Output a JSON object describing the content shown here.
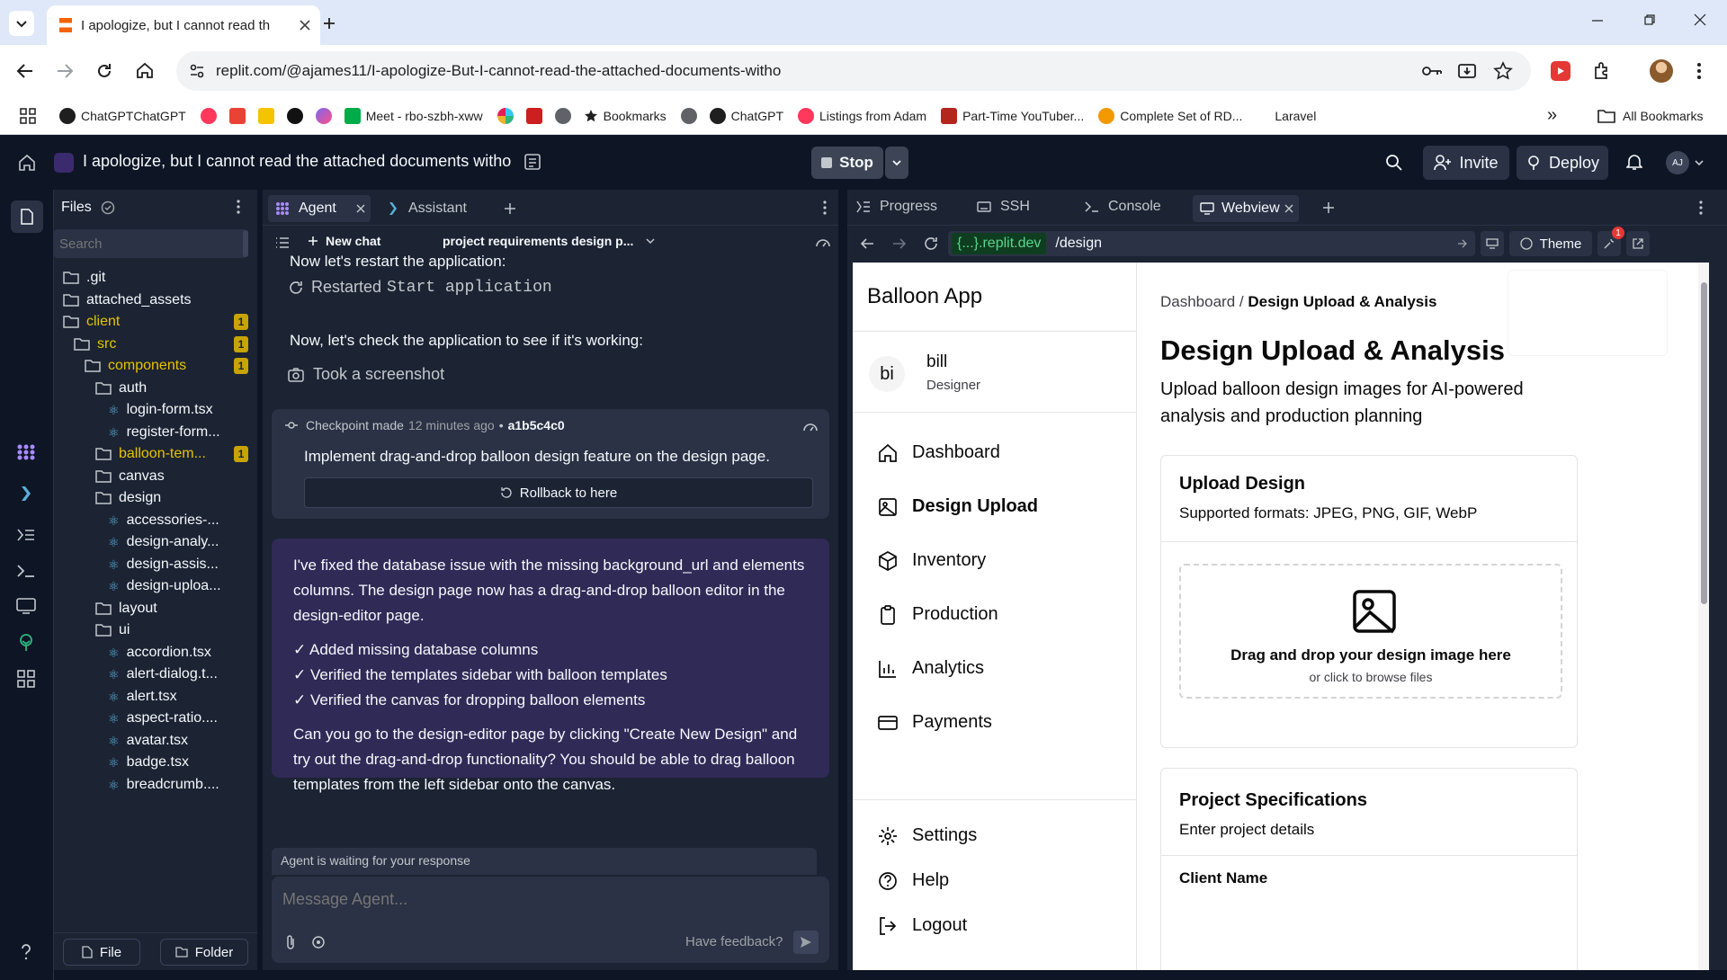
{
  "browser": {
    "tab_title": "I apologize, but I cannot read th",
    "url": "replit.com/@ajames11/I-apologize-But-I-cannot-read-the-attached-documents-witho",
    "bookmarks": [
      "ChatGPTChatGPT",
      "Meet - rbo-szbh-xww",
      "Bookmarks",
      "ChatGPT",
      "Listings from Adam",
      "Part-Time YouTuber...",
      "Complete Set of RD...",
      "Laravel"
    ],
    "all_bookmarks": "All Bookmarks",
    "more": "»"
  },
  "replit": {
    "project_title": "I apologize, but I cannot read the attached documents witho",
    "stop_label": "Stop",
    "invite_label": "Invite",
    "deploy_label": "Deploy",
    "avatar_initials": "AJ"
  },
  "files": {
    "header": "Files",
    "search_placeholder": "Search",
    "new_file": "File",
    "new_folder": "Folder",
    "tree": [
      {
        "name": ".git",
        "badge": ""
      },
      {
        "name": "attached_assets",
        "badge": ""
      },
      {
        "name": "client",
        "badge": "1"
      },
      {
        "name": "src",
        "badge": "1"
      },
      {
        "name": "components",
        "badge": "1"
      },
      {
        "name": "auth",
        "badge": ""
      },
      {
        "name": "login-form.tsx",
        "badge": ""
      },
      {
        "name": "register-form...",
        "badge": ""
      },
      {
        "name": "balloon-tem...",
        "badge": "1"
      },
      {
        "name": "canvas",
        "badge": ""
      },
      {
        "name": "design",
        "badge": ""
      },
      {
        "name": "accessories-...",
        "badge": ""
      },
      {
        "name": "design-analy...",
        "badge": ""
      },
      {
        "name": "design-assis...",
        "badge": ""
      },
      {
        "name": "design-uploa...",
        "badge": ""
      },
      {
        "name": "layout",
        "badge": ""
      },
      {
        "name": "ui",
        "badge": ""
      },
      {
        "name": "accordion.tsx",
        "badge": ""
      },
      {
        "name": "alert-dialog.t...",
        "badge": ""
      },
      {
        "name": "alert.tsx",
        "badge": ""
      },
      {
        "name": "aspect-ratio....",
        "badge": ""
      },
      {
        "name": "avatar.tsx",
        "badge": ""
      },
      {
        "name": "badge.tsx",
        "badge": ""
      },
      {
        "name": "breadcrumb....",
        "badge": ""
      }
    ]
  },
  "agent": {
    "tabs": [
      "Agent",
      "Assistant"
    ],
    "new_chat": "New chat",
    "chat_title": "project requirements design p...",
    "msg1": "Now let's restart the application:",
    "restarted_prefix": "Restarted",
    "restarted_code": "Start application",
    "msg2": "Now, let's check the application to see if it's working:",
    "screenshot": "Took a screenshot",
    "checkpoint": {
      "label": "Checkpoint made",
      "time": "12 minutes ago",
      "hash": "a1b5c4c0",
      "desc": "Implement drag-and-drop balloon design feature on the design page.",
      "rollback": "Rollback to here"
    },
    "reply": {
      "p1": "I've fixed the database issue with the missing background_url and elements columns. The design page now has a drag-and-drop balloon editor in the design-editor page.",
      "checks": [
        "✓ Added missing database columns",
        "✓ Verified the templates sidebar with balloon templates",
        "✓ Verified the canvas for dropping balloon elements"
      ],
      "p2": "Can you go to the design-editor page by clicking \"Create New Design\" and try out the drag-and-drop functionality? You should be able to drag balloon templates from the left sidebar onto the canvas."
    },
    "waiting": "Agent is waiting for your response",
    "input_placeholder": "Message Agent...",
    "feedback": "Have feedback?"
  },
  "webview_panel": {
    "tabs": [
      "Progress",
      "SSH",
      "Console",
      "Webview"
    ],
    "url_host": "{...}.replit.dev",
    "url_path": "/design",
    "theme": "Theme",
    "notif_count": "1"
  },
  "app": {
    "brand": "Balloon App",
    "user": {
      "initials": "bi",
      "name": "bill",
      "role": "Designer"
    },
    "nav": [
      "Dashboard",
      "Design Upload",
      "Inventory",
      "Production",
      "Analytics",
      "Payments"
    ],
    "nav_bottom": [
      "Settings",
      "Help",
      "Logout"
    ],
    "breadcrumb_parent": "Dashboard",
    "breadcrumb_sep": "/",
    "breadcrumb_current": "Design Upload & Analysis",
    "page_title": "Design Upload & Analysis",
    "page_subtitle": "Upload balloon design images for AI-powered analysis and production planning",
    "upload_card": {
      "title": "Upload Design",
      "formats": "Supported formats: JPEG, PNG, GIF, WebP",
      "drop_title": "Drag and drop your design image here",
      "drop_sub": "or click to browse files"
    },
    "spec_card": {
      "title": "Project Specifications",
      "sub": "Enter project details",
      "field1": "Client Name"
    }
  }
}
